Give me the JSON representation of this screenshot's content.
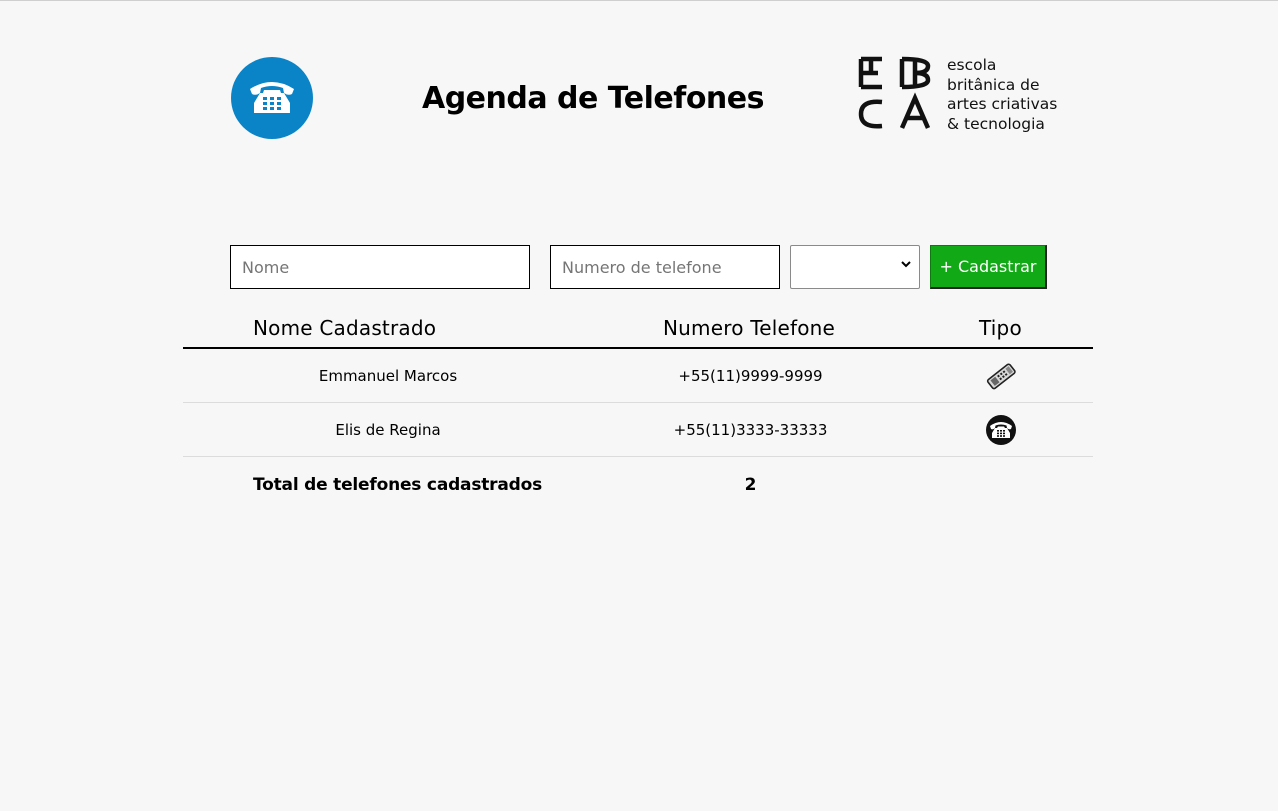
{
  "header": {
    "title": "Agenda de Telefones",
    "logo_icon": "telephone-icon",
    "brand": {
      "mark": "EBAC",
      "lines": [
        "escola",
        "britânica de",
        "artes criativas",
        "& tecnologia"
      ]
    }
  },
  "form": {
    "name_placeholder": "Nome",
    "name_value": "",
    "number_placeholder": "Numero de telefone",
    "number_value": "",
    "type_selected": "",
    "submit_label": "+ Cadastrar"
  },
  "table": {
    "columns": [
      "Nome Cadastrado",
      "Numero Telefone",
      "Tipo"
    ],
    "rows": [
      {
        "name": "Emmanuel Marcos",
        "number": "+55(11)9999-9999",
        "type_icon": "mobile-phone-icon"
      },
      {
        "name": "Elis de Regina",
        "number": "+55(11)3333-33333",
        "type_icon": "landline-phone-icon"
      }
    ],
    "footer": {
      "label": "Total de telefones cadastrados",
      "total": "2"
    }
  },
  "colors": {
    "background": "#f7f7f7",
    "logo_blue": "#0a84c7",
    "button_green": "#12a916",
    "text": "#000000"
  }
}
